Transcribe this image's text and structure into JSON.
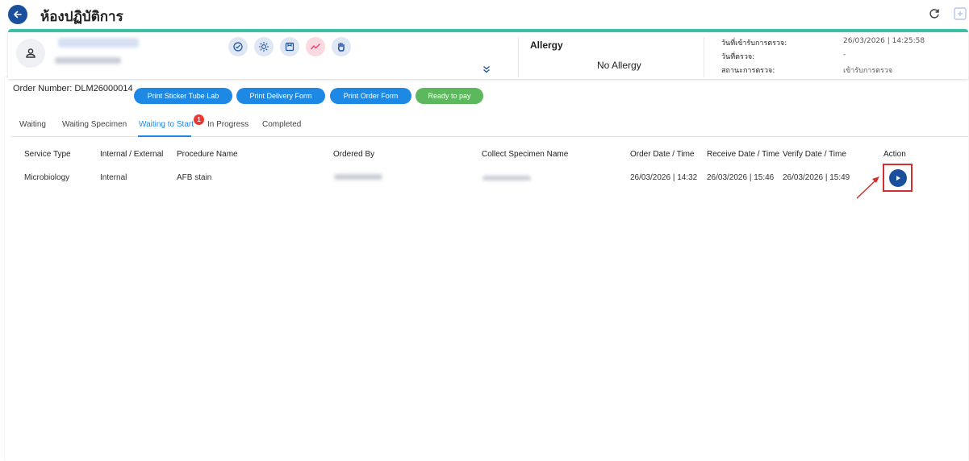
{
  "header": {
    "title": "ห้องปฏิบัติการ",
    "back_icon": "back-arrow-icon",
    "refresh_icon": "refresh-icon",
    "export_icon": "export-icon"
  },
  "patient": {
    "avatar_icon": "user-icon",
    "quick_icons": [
      "vitals-icon",
      "sun-icon",
      "notes-icon",
      "trend-icon",
      "hand-icon"
    ],
    "allergy_label": "Allergy",
    "allergy_value": "No Allergy",
    "info": [
      {
        "label": "วันที่เข้ารับการตรวจ:",
        "value": "26/03/2026 | 14:25:58"
      },
      {
        "label": "วันที่ตรวจ:",
        "value": "-"
      },
      {
        "label": "สถานะการตรวจ:",
        "value": "เข้ารับการตรวจ"
      }
    ]
  },
  "order": {
    "number": "Order Number: DLM26000014",
    "buttons": [
      "Print Sticker Tube Lab",
      "Print Delivery Form",
      "Print Order Form",
      "Ready to pay"
    ]
  },
  "tabs": {
    "items": [
      "Waiting",
      "Waiting Specimen",
      "Waiting to Start",
      "In Progress",
      "Completed"
    ],
    "active": "Waiting to Start",
    "badge": "1"
  },
  "table": {
    "columns": [
      "Service Type",
      "Internal / External",
      "Procedure Name",
      "Ordered By",
      "Collect Specimen Name",
      "Order Date / Time",
      "Receive Date / Time",
      "Verify Date / Time",
      "Action"
    ],
    "rows": [
      {
        "service_type": "Microbiology",
        "internal_external": "Internal",
        "procedure_name": "AFB stain",
        "order_date": "26/03/2026 | 14:32",
        "receive_date": "26/03/2026 | 15:46",
        "verify_date": "26/03/2026 | 15:49",
        "action_icon": "play-icon"
      }
    ]
  },
  "colors": {
    "primary": "#1e88e5",
    "dark_blue": "#1a4f9c",
    "teal": "#3bbfa5",
    "green": "#5cb85c",
    "badge_red": "#e53935",
    "annotation_red": "#d32f2f"
  }
}
